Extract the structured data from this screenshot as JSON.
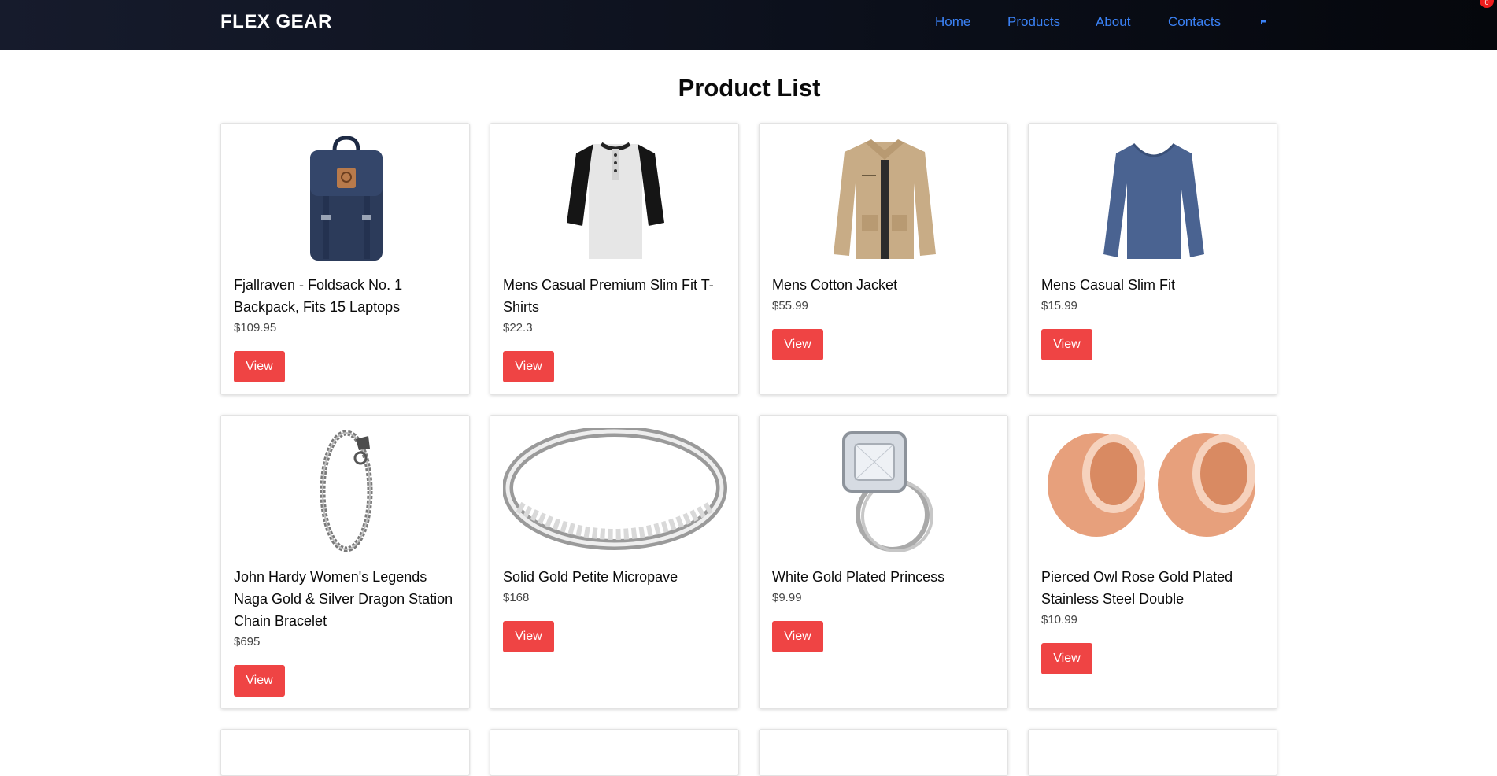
{
  "brand": "FLEX GEAR",
  "nav": {
    "home": "Home",
    "products": "Products",
    "about": "About",
    "contacts": "Contacts"
  },
  "cart_count": "0",
  "page_title": "Product List",
  "view_label": "View",
  "colors": {
    "accent_red": "#ef4444",
    "nav_link": "#3b82f6",
    "navbar_bg": "#0b0f1a"
  },
  "products": [
    {
      "title": "Fjallraven - Foldsack No. 1 Backpack, Fits 15 Laptops",
      "price": "$109.95",
      "icon": "backpack-icon"
    },
    {
      "title": "Mens Casual Premium Slim Fit T-Shirts",
      "price": "$22.3",
      "icon": "tshirt-icon"
    },
    {
      "title": "Mens Cotton Jacket",
      "price": "$55.99",
      "icon": "jacket-icon"
    },
    {
      "title": "Mens Casual Slim Fit",
      "price": "$15.99",
      "icon": "longsleeve-icon"
    },
    {
      "title": "John Hardy Women's Legends Naga Gold & Silver Dragon Station Chain Bracelet",
      "price": "$695",
      "icon": "bracelet-icon"
    },
    {
      "title": "Solid Gold Petite Micropave",
      "price": "$168",
      "icon": "ring-band-icon"
    },
    {
      "title": "White Gold Plated Princess",
      "price": "$9.99",
      "icon": "ring-diamond-icon"
    },
    {
      "title": "Pierced Owl Rose Gold Plated Stainless Steel Double",
      "price": "$10.99",
      "icon": "plugs-icon"
    }
  ]
}
